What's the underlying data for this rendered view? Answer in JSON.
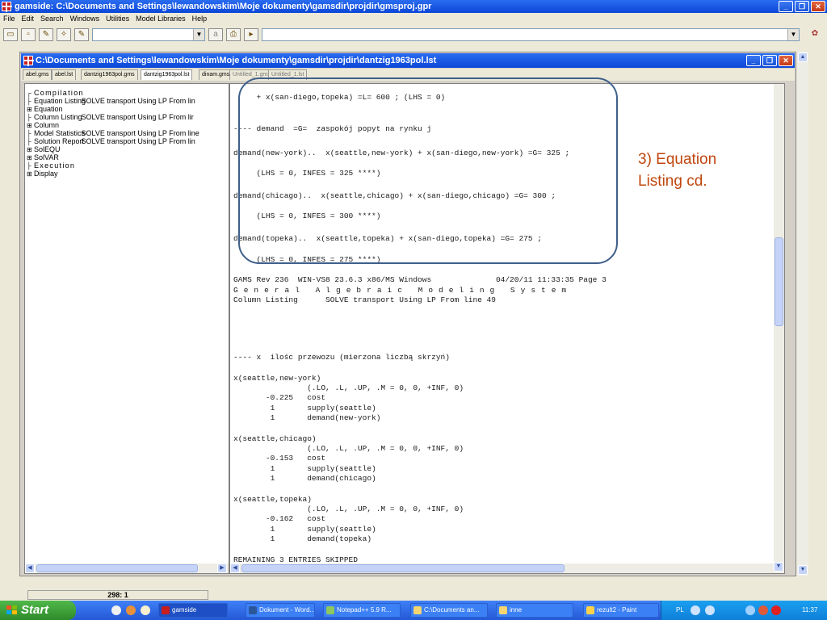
{
  "app_title": "gamside: C:\\Documents and Settings\\lewandowskim\\Moje dokumenty\\gamsdir\\projdir\\gmsproj.gpr",
  "menu": [
    "File",
    "Edit",
    "Search",
    "Windows",
    "Utilities",
    "Model Libraries",
    "Help"
  ],
  "child_title": "C:\\Documents and Settings\\lewandowskim\\Moje dokumenty\\gamsdir\\projdir\\dantzig1963pol.lst",
  "tabs": [
    "abel.gms",
    "abel.lst",
    "dantzig1963pol.gms",
    "dantzig1963pol.lst",
    "dinam.gms",
    "Untitled_1.gms",
    "Untitled_1.lst"
  ],
  "tree": [
    {
      "label": "Compilation",
      "desc": ""
    },
    {
      "label": "Equation Listing",
      "desc": "SOLVE transport Using LP From lin"
    },
    {
      "label": "Equation",
      "desc": ""
    },
    {
      "label": "Column Listing",
      "desc": "SOLVE transport Using LP From lir"
    },
    {
      "label": "Column",
      "desc": ""
    },
    {
      "label": "Model Statistics",
      "desc": "SOLVE transport Using LP From line"
    },
    {
      "label": "Solution Report",
      "desc": "SOLVE transport Using LP From lin"
    },
    {
      "label": "SolEQU",
      "desc": ""
    },
    {
      "label": "SolVAR",
      "desc": ""
    },
    {
      "label": "Execution",
      "desc": ""
    },
    {
      "label": "Display",
      "desc": ""
    }
  ],
  "listing": [
    "     + x(san-diego,topeka) =L= 600 ; (LHS = 0)",
    "---- demand  =G=  zaspokój popyt na rynku j",
    "demand(new-york)..  x(seattle,new-york) + x(san-diego,new-york) =G= 325 ;",
    "     (LHS = 0, INFES = 325 ****)",
    "demand(chicago)..  x(seattle,chicago) + x(san-diego,chicago) =G= 300 ;",
    "     (LHS = 0, INFES = 300 ****)",
    "demand(topeka)..  x(seattle,topeka) + x(san-diego,topeka) =G= 275 ;",
    "     (LHS = 0, INFES = 275 ****)",
    "GAMS Rev 236  WIN-VS8 23.6.3 x86/MS Windows              04/20/11 11:33:35 Page 3",
    "General Algebraic Modeling System",
    "Column Listing      SOLVE transport Using LP From line 49",
    "---- x  ilośc przewozu (mierzona liczbą skrzyń)",
    "x(seattle,new-york)",
    "                (.LO, .L, .UP, .M = 0, 0, +INF, 0)",
    "       -0.225   cost",
    "        1       supply(seattle)",
    "        1       demand(new-york)",
    "x(seattle,chicago)",
    "                (.LO, .L, .UP, .M = 0, 0, +INF, 0)",
    "       -0.153   cost",
    "        1       supply(seattle)",
    "        1       demand(chicago)",
    "x(seattle,topeka)",
    "                (.LO, .L, .UP, .M = 0, 0, +INF, 0)",
    "       -0.162   cost",
    "        1       supply(seattle)",
    "        1       demand(topeka)",
    "REMAINING 3 ENTRIES SKIPPED"
  ],
  "callout": {
    "line1": "3) Equation",
    "line2": "Listing cd.",
    "color": "#c0460e"
  },
  "status": {
    "position": "298: 1"
  },
  "taskbar": {
    "start": "Start",
    "items": [
      "gamside",
      "Dokument - Word...",
      "Notepad++ 5.9 R...",
      "C:\\Documents an...",
      "inne",
      "rezult2 - Paint"
    ],
    "lang": "PL",
    "clock": "11:37"
  }
}
